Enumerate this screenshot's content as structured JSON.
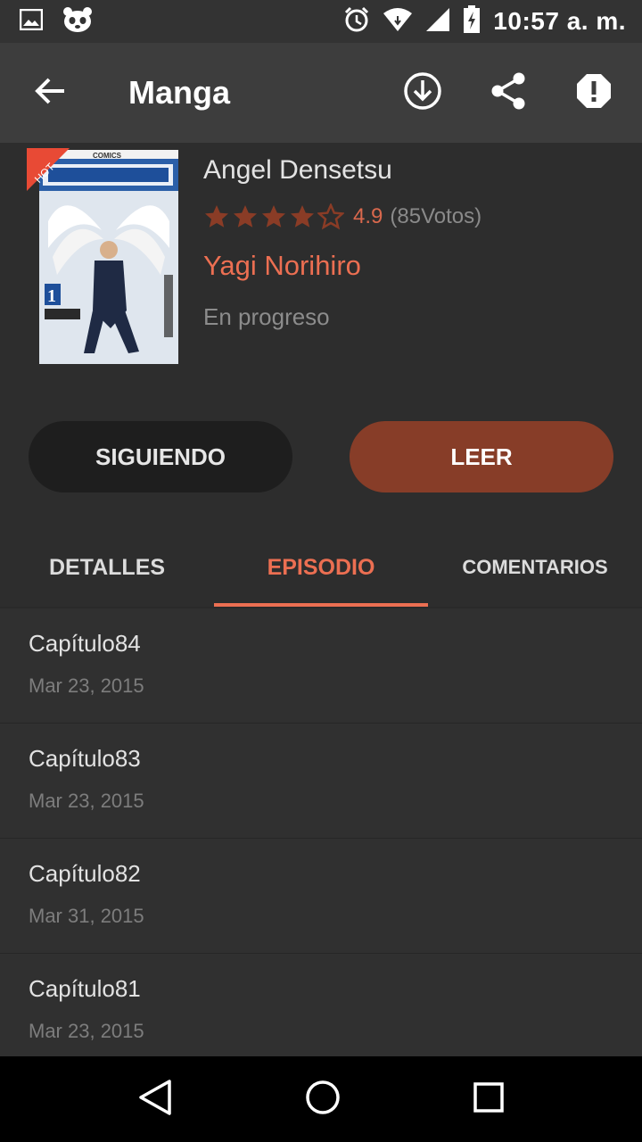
{
  "status_bar": {
    "time": "10:57 a. m.",
    "left_icons": [
      "image-icon",
      "panda-icon"
    ],
    "right_icons": [
      "alarm-icon",
      "wifi-icon",
      "signal-icon",
      "battery-charging-icon"
    ]
  },
  "app_bar": {
    "title": "Manga",
    "actions": [
      "download-icon",
      "share-icon",
      "report-icon"
    ]
  },
  "manga": {
    "badge": "HOT",
    "title": "Angel Densetsu",
    "rating_stars": 4,
    "rating_max": 5,
    "rating_value": "4.9",
    "votes": "(85Votos)",
    "author": "Yagi Norihiro",
    "status": "En progreso"
  },
  "buttons": {
    "follow": "SIGUIENDO",
    "read": "LEER"
  },
  "tabs": [
    {
      "label": "DETALLES"
    },
    {
      "label": "EPISODIO",
      "active": true
    },
    {
      "label": "COMENTARIOS"
    }
  ],
  "chapters": [
    {
      "name": "Capítulo84",
      "date": "Mar 23, 2015"
    },
    {
      "name": "Capítulo83",
      "date": "Mar 23, 2015"
    },
    {
      "name": "Capítulo82",
      "date": "Mar 31, 2015"
    },
    {
      "name": "Capítulo81",
      "date": "Mar 23, 2015"
    }
  ],
  "colors": {
    "accent": "#ec6f52",
    "read_button": "#873d28",
    "star": "#8a3c26"
  }
}
